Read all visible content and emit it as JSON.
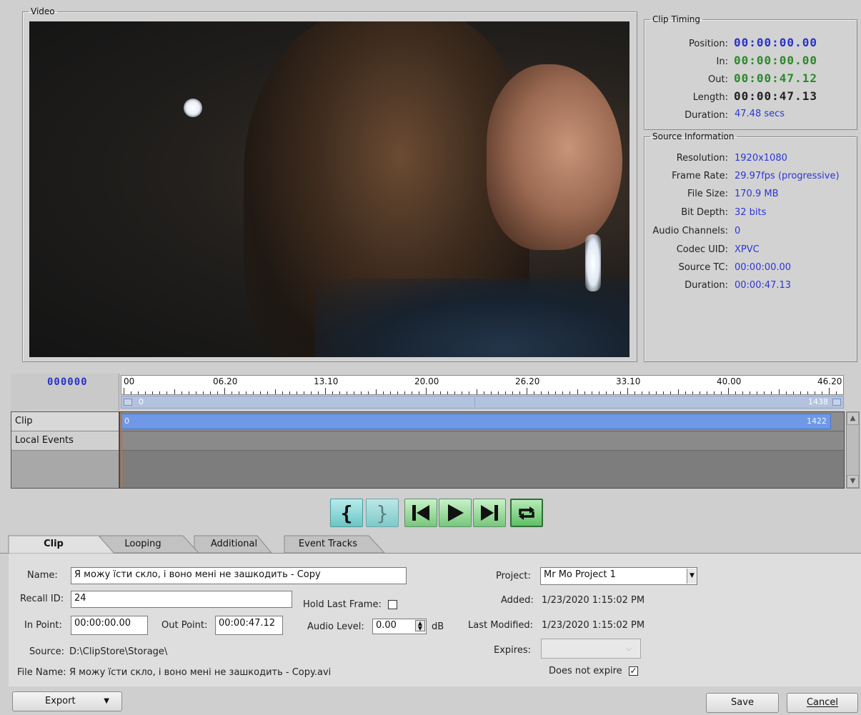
{
  "video": {
    "legend": "Video"
  },
  "clip_timing": {
    "legend": "Clip Timing",
    "rows": [
      {
        "label": "Position:",
        "value": "00:00:00.00",
        "color": "#2833c9"
      },
      {
        "label": "In:",
        "value": "00:00:00.00",
        "color": "#2a8a2a"
      },
      {
        "label": "Out:",
        "value": "00:00:47.12",
        "color": "#2a8a2a"
      },
      {
        "label": "Length:",
        "value": "00:00:47.13",
        "color": "#222222"
      }
    ],
    "duration_label": "Duration:",
    "duration_value": "47.48 secs"
  },
  "source_info": {
    "legend": "Source Information",
    "rows": [
      {
        "label": "Resolution:",
        "value": "1920x1080"
      },
      {
        "label": "Frame Rate:",
        "value": "29.97fps (progressive)"
      },
      {
        "label": "File Size:",
        "value": "170.9 MB"
      },
      {
        "label": "Bit Depth:",
        "value": "32 bits"
      },
      {
        "label": "Audio Channels:",
        "value": "0"
      },
      {
        "label": "Codec UID:",
        "value": "XPVC"
      },
      {
        "label": "Source TC:",
        "value": "00:00:00.00"
      },
      {
        "label": "Duration:",
        "value": "00:00:47.13"
      }
    ]
  },
  "timeline": {
    "frame_counter": "000000",
    "ruler_labels": [
      "00",
      "06.20",
      "13.10",
      "20.00",
      "26.20",
      "33.10",
      "40.00",
      "46.20"
    ],
    "range_start": "0",
    "range_end": "1438",
    "tracks": [
      {
        "label": "Clip"
      },
      {
        "label": "Local Events"
      }
    ],
    "clip_start": "0",
    "clip_end": "1422"
  },
  "transport": {
    "icons": [
      "mark-in-icon",
      "mark-out-icon",
      "skip-start-icon",
      "play-icon",
      "skip-end-icon",
      "loop-icon"
    ]
  },
  "tabs": [
    {
      "label": "Clip",
      "active": true
    },
    {
      "label": "Looping",
      "active": false
    },
    {
      "label": "Additional",
      "active": false
    },
    {
      "label": "Event Tracks",
      "active": false
    }
  ],
  "form": {
    "name_label": "Name:",
    "name_value": "Я можу їсти скло, і воно мені не зашкодить - Copy",
    "recall_label": "Recall ID:",
    "recall_value": "24",
    "hold_label": "Hold Last Frame:",
    "in_label": "In Point:",
    "in_value": "00:00:00.00",
    "out_label": "Out Point:",
    "out_value": "00:00:47.12",
    "audio_label": "Audio Level:",
    "audio_value": "0.00",
    "audio_unit": "dB",
    "source_label": "Source:",
    "source_value": "D:\\ClipStore\\Storage\\",
    "filename_label": "File Name:",
    "filename_value": "Я можу їсти скло, і воно мені не зашкодить - Copy.avi",
    "project_label": "Project:",
    "project_value": "Mr Mo Project 1",
    "added_label": "Added:",
    "added_value": "1/23/2020 1:15:02 PM",
    "modified_label": "Last Modified:",
    "modified_value": "1/23/2020 1:15:02 PM",
    "expires_label": "Expires:",
    "expires_value": "",
    "noexpire_label": "Does not expire"
  },
  "buttons": {
    "export": "Export",
    "save": "Save",
    "cancel": "Cancel"
  }
}
